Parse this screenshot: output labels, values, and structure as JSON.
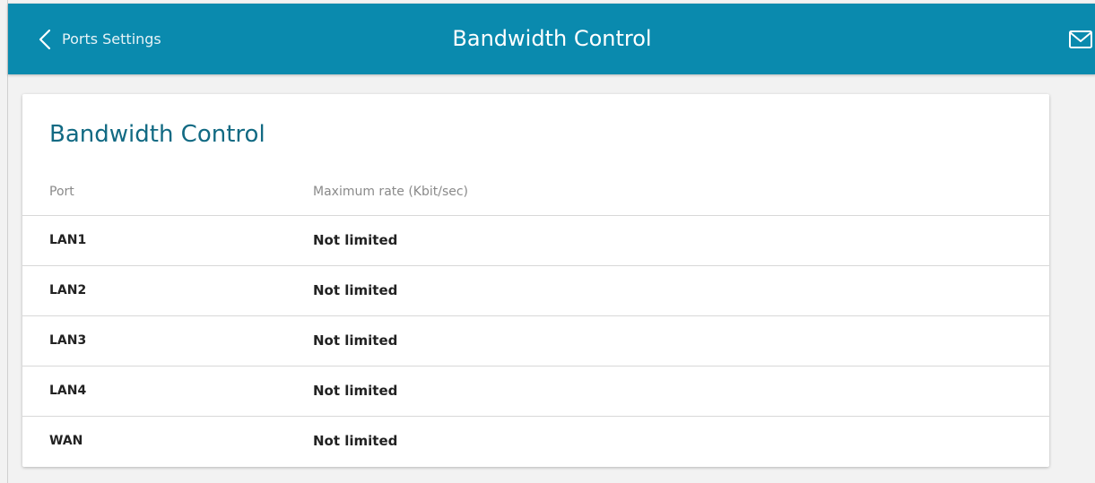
{
  "header": {
    "back_label": "Ports Settings",
    "title": "Bandwidth Control",
    "back_icon": "chevron-left-icon",
    "mail_icon": "envelope-icon"
  },
  "card": {
    "title": "Bandwidth Control",
    "columns": {
      "port": "Port",
      "rate": "Maximum rate (Kbit/sec)"
    },
    "rows": [
      {
        "port": "LAN1",
        "rate": "Not limited"
      },
      {
        "port": "LAN2",
        "rate": "Not limited"
      },
      {
        "port": "LAN3",
        "rate": "Not limited"
      },
      {
        "port": "LAN4",
        "rate": "Not limited"
      },
      {
        "port": "WAN",
        "rate": "Not limited"
      }
    ]
  },
  "colors": {
    "header_bg": "#0a8aae",
    "title_text": "#126a83"
  }
}
